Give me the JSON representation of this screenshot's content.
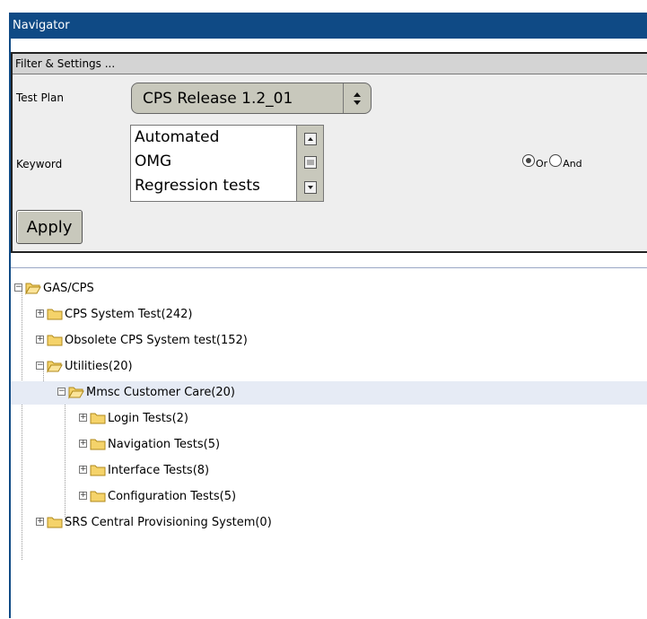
{
  "window": {
    "title": "Navigator"
  },
  "filter": {
    "header": "Filter & Settings ...",
    "test_plan_label": "Test Plan",
    "test_plan_value": "CPS Release 1.2_01",
    "keyword_label": "Keyword",
    "keywords": [
      "Automated",
      "OMG",
      "Regression tests"
    ],
    "logic_options": [
      {
        "label": "Or",
        "selected": true
      },
      {
        "label": "And",
        "selected": false
      }
    ],
    "apply_label": "Apply"
  },
  "tree": {
    "nodes": [
      {
        "label": "GAS/CPS",
        "expanded": true
      },
      {
        "label": "CPS System Test(242)",
        "expanded": false
      },
      {
        "label": "Obsolete CPS System test(152)",
        "expanded": false
      },
      {
        "label": "Utilities(20)",
        "expanded": true
      },
      {
        "label": "Mmsc Customer Care(20)",
        "expanded": true,
        "selected": true
      },
      {
        "label": "Login Tests(2)",
        "expanded": false
      },
      {
        "label": "Navigation Tests(5)",
        "expanded": false
      },
      {
        "label": "Interface Tests(8)",
        "expanded": false
      },
      {
        "label": "Configuration Tests(5)",
        "expanded": false
      },
      {
        "label": "SRS Central Provisioning System(0)",
        "expanded": false
      }
    ]
  },
  "colors": {
    "titlebar": "#0f4a85",
    "folder": "#f5d36a",
    "selection": "#e6ebf5"
  }
}
